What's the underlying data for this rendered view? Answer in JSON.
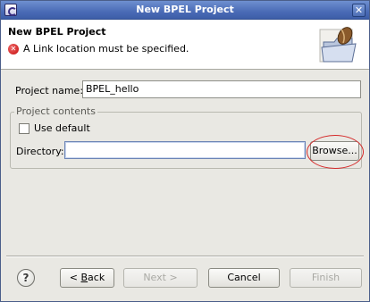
{
  "window": {
    "title": "New BPEL Project",
    "close_glyph": "✕",
    "app_icon": "eclipse-icon"
  },
  "header": {
    "title": "New BPEL Project",
    "message": "A Link location must be specified.",
    "message_icon": "error-icon",
    "error_glyph": "✕",
    "banner_icon": "folder-bean-icon"
  },
  "form": {
    "project_name_label": "Project name:",
    "project_name_value": "BPEL_hello",
    "group_label": "Project contents",
    "use_default_label": "Use default",
    "use_default_checked": false,
    "directory_label": "Directory:",
    "directory_value": "",
    "browse_label": "Browse...",
    "browse_highlight_color": "#d52a2a"
  },
  "footer": {
    "help_glyph": "?",
    "back_arrow": "< ",
    "back_mnemonic": "B",
    "back_rest": "ack",
    "next_label": "Next >",
    "cancel_label": "Cancel",
    "finish_label": "Finish"
  }
}
